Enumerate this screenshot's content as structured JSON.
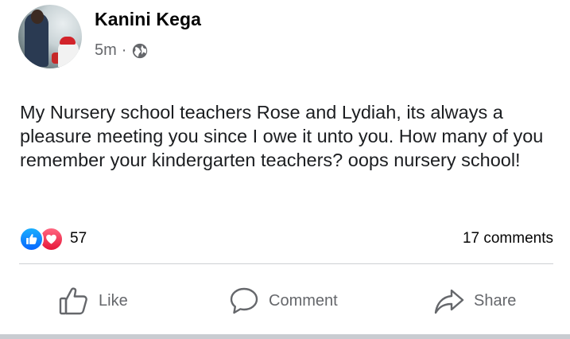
{
  "post": {
    "author": "Kanini Kega",
    "time": "5m",
    "separator": "·",
    "privacy_icon": "globe-icon",
    "text": "My Nursery school teachers Rose and Lydiah, its always a pleasure meeting you since I owe it unto you. How many of you remember your kindergarten teachers? oops nursery school!",
    "reactions": {
      "types": [
        "like",
        "love"
      ],
      "count": "57",
      "colors": {
        "like": "#0866ff",
        "love": "#e61739"
      }
    },
    "comments_count": "17 comments"
  },
  "actions": {
    "like_label": "Like",
    "comment_label": "Comment",
    "share_label": "Share"
  },
  "colors": {
    "text_primary": "#050505",
    "text_secondary": "#65676b",
    "divider": "#ced0d4"
  }
}
